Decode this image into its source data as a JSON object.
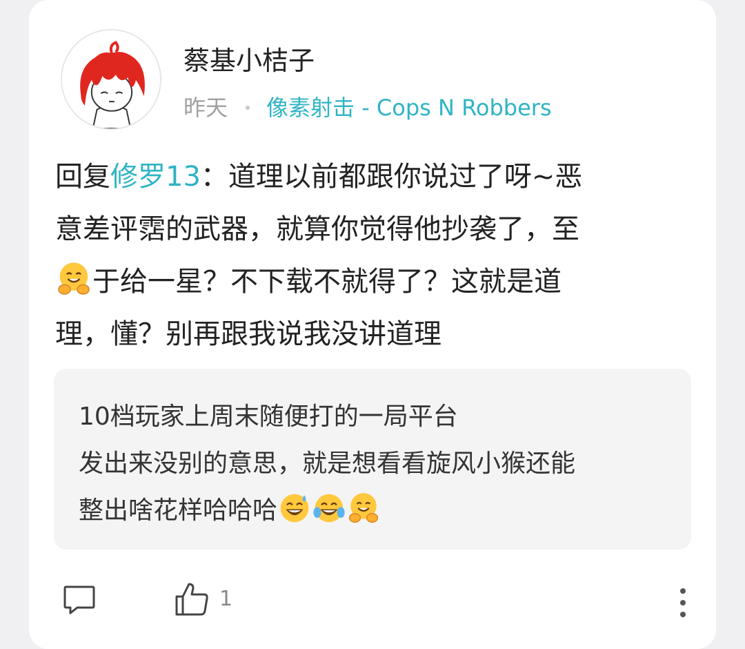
{
  "post": {
    "username": "蔡基小桔子",
    "time": "昨天",
    "game": "像素射击 - Cops N Robbers"
  },
  "comment": {
    "prefix": "回复",
    "mention": "修罗13",
    "line1_rest": "：道理以前都跟你说过了呀~恶",
    "line2": "意差评霑的武器，就算你觉得他抄袭了，至",
    "line3": "于给一星？不下载不就得了？这就是道",
    "line4": "理，懂？别再跟我说我没讲道理",
    "emoji": "hugging-face-emoji"
  },
  "quote": {
    "line1": "10档玩家上周末随便打的一局平台",
    "line2": "发出来没别的意思，就是想看看旋风小猴还能",
    "line3": "整出啥花样哈哈哈",
    "emojis": [
      "grinning-sweat-emoji",
      "tears-of-joy-emoji",
      "hugging-face-emoji"
    ]
  },
  "actions": {
    "like_count": "1",
    "comment_icon": "comment-bubble-icon",
    "like_icon": "thumbs-up-icon",
    "more_icon": "more-vertical-icon"
  },
  "colors": {
    "accent": "#2fb4c4",
    "text": "#222222",
    "muted": "#a0a0a0",
    "quote_bg": "#f4f4f4"
  }
}
